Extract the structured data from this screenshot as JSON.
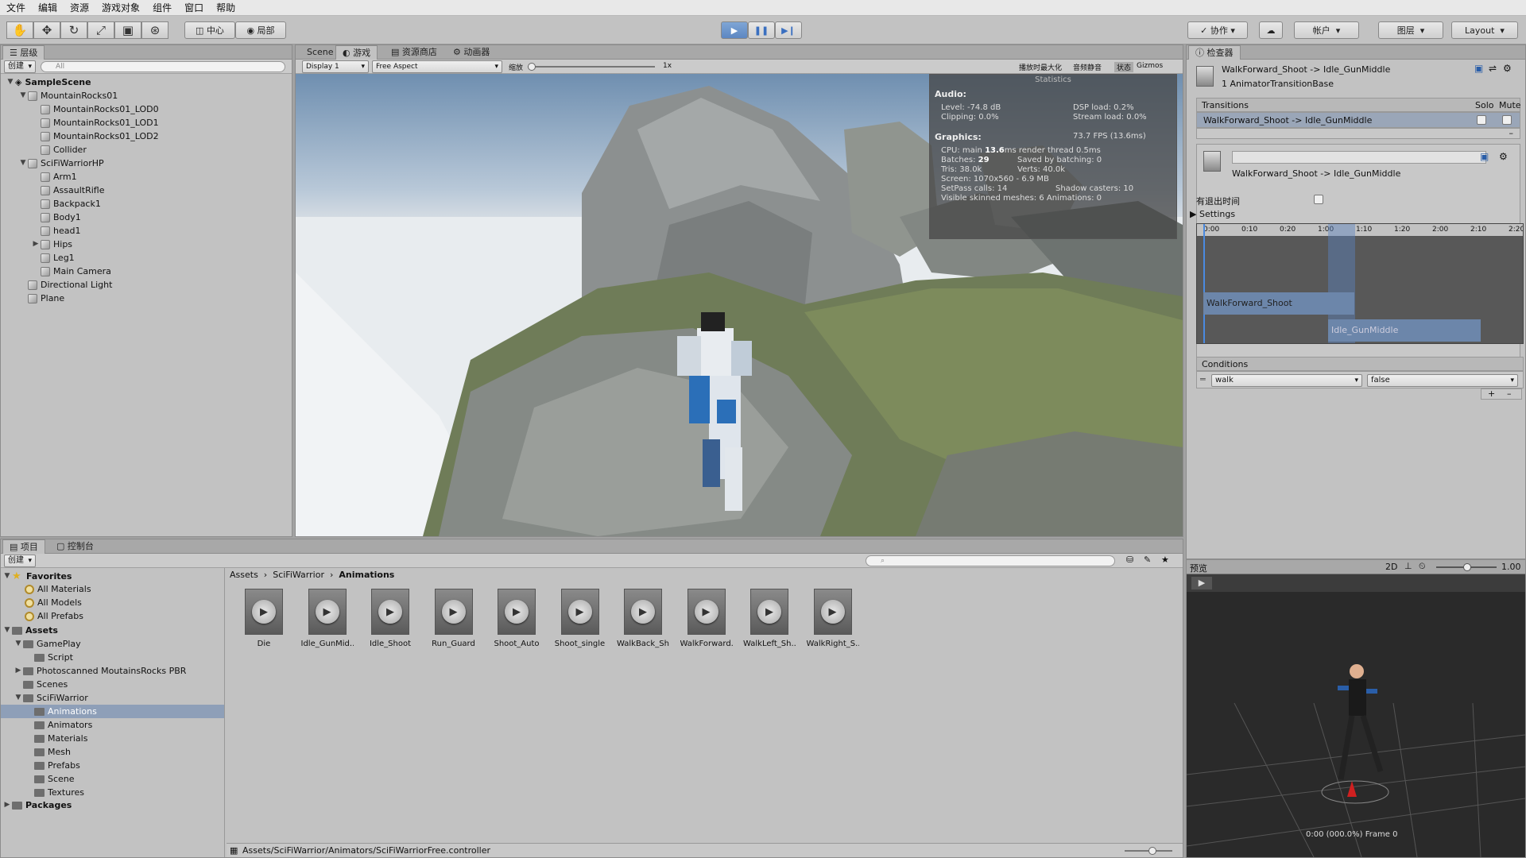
{
  "menu": [
    "文件",
    "编辑",
    "资源",
    "游戏对象",
    "组件",
    "窗口",
    "帮助"
  ],
  "toolbar": {
    "pivot_label": "中心",
    "local_label": "局部",
    "collab_label": "协作",
    "account_label": "帐户",
    "layers_label": "图层",
    "layout_label": "Layout"
  },
  "hierarchy": {
    "tab": "层级",
    "create": "创建",
    "search_placeholder": "All",
    "scene": "SampleScene",
    "items": [
      {
        "label": "MountainRocks01",
        "depth": 1,
        "fold": "▼"
      },
      {
        "label": "MountainRocks01_LOD0",
        "depth": 2,
        "fold": ""
      },
      {
        "label": "MountainRocks01_LOD1",
        "depth": 2,
        "fold": ""
      },
      {
        "label": "MountainRocks01_LOD2",
        "depth": 2,
        "fold": ""
      },
      {
        "label": "Collider",
        "depth": 2,
        "fold": ""
      },
      {
        "label": "SciFiWarriorHP",
        "depth": 1,
        "fold": "▼"
      },
      {
        "label": "Arm1",
        "depth": 2,
        "fold": ""
      },
      {
        "label": "AssaultRifle",
        "depth": 2,
        "fold": ""
      },
      {
        "label": "Backpack1",
        "depth": 2,
        "fold": ""
      },
      {
        "label": "Body1",
        "depth": 2,
        "fold": ""
      },
      {
        "label": "head1",
        "depth": 2,
        "fold": ""
      },
      {
        "label": "Hips",
        "depth": 2,
        "fold": "▶"
      },
      {
        "label": "Leg1",
        "depth": 2,
        "fold": ""
      },
      {
        "label": "Main Camera",
        "depth": 2,
        "fold": ""
      },
      {
        "label": "Directional Light",
        "depth": 1,
        "fold": ""
      },
      {
        "label": "Plane",
        "depth": 1,
        "fold": ""
      }
    ]
  },
  "game": {
    "tabs": [
      "Scene",
      "游戏",
      "资源商店",
      "动画器"
    ],
    "display": "Display 1",
    "aspect": "Free Aspect",
    "scale_label": "缩放",
    "scale_value": "1x",
    "maximize_label": "播放时最大化",
    "mute_label": "音频静音",
    "stats_label": "状态",
    "gizmos_label": "Gizmos",
    "statistics": {
      "title": "Statistics",
      "audio_header": "Audio:",
      "level": "Level: -74.8 dB",
      "clipping": "Clipping: 0.0%",
      "dsp": "DSP load: 0.2%",
      "stream": "Stream load: 0.0%",
      "graphics_header": "Graphics:",
      "fps": "73.7 FPS (13.6ms)",
      "cpu_prefix": "CPU: main",
      "cpu_main": "13.6",
      "cpu_suffix": "ms  render thread 0.5ms",
      "batches_prefix": "Batches:",
      "batches": "29",
      "saved_batching": "Saved by batching: 0",
      "tris": "Tris: 38.0k",
      "verts": "Verts: 40.0k",
      "screen": "Screen: 1070x560 - 6.9 MB",
      "setpass": "SetPass calls: 14",
      "shadow": "Shadow casters: 10",
      "skinned": "Visible skinned meshes: 6  Animations: 0"
    }
  },
  "inspector": {
    "tab": "检查器",
    "title": "WalkForward_Shoot -> Idle_GunMiddle",
    "subtitle": "1 AnimatorTransitionBase",
    "transitions_header": "Transitions",
    "solo": "Solo",
    "mute": "Mute",
    "transition_row": "WalkForward_Shoot -> Idle_GunMiddle",
    "minus": "–",
    "transition_name": "WalkForward_Shoot -> Idle_GunMiddle",
    "has_exit_time": "有退出时间",
    "settings": "Settings",
    "timeline_ticks": [
      "0:00",
      "0:10",
      "0:20",
      "1:00",
      "1:10",
      "1:20",
      "2:00",
      "2:10",
      "2:20"
    ],
    "clip_a": "WalkForward_Shoot",
    "clip_b": "Idle_GunMiddle",
    "conditions_header": "Conditions",
    "condition_param": "walk",
    "condition_value": "false",
    "plus": "+",
    "minus2": "–"
  },
  "preview": {
    "label": "预览",
    "mode_2d": "2D",
    "speed": "1.00",
    "status": "0:00 (000.0%) Frame 0"
  },
  "project": {
    "tab": "项目",
    "console_tab": "控制台",
    "create": "创建",
    "favorites_header": "Favorites",
    "favorites": [
      "All Materials",
      "All Models",
      "All Prefabs"
    ],
    "assets_header": "Assets",
    "assets_tree": [
      {
        "label": "GamePlay",
        "depth": 1,
        "fold": "▼"
      },
      {
        "label": "Script",
        "depth": 2,
        "fold": ""
      },
      {
        "label": "Photoscanned MoutainsRocks PBR",
        "depth": 1,
        "fold": "▶"
      },
      {
        "label": "Scenes",
        "depth": 1,
        "fold": ""
      },
      {
        "label": "SciFiWarrior",
        "depth": 1,
        "fold": "▼"
      },
      {
        "label": "Animations",
        "depth": 2,
        "fold": "",
        "selected": true
      },
      {
        "label": "Animators",
        "depth": 2,
        "fold": ""
      },
      {
        "label": "Materials",
        "depth": 2,
        "fold": ""
      },
      {
        "label": "Mesh",
        "depth": 2,
        "fold": ""
      },
      {
        "label": "Prefabs",
        "depth": 2,
        "fold": ""
      },
      {
        "label": "Scene",
        "depth": 2,
        "fold": ""
      },
      {
        "label": "Textures",
        "depth": 2,
        "fold": ""
      }
    ],
    "packages_header": "Packages",
    "breadcrumb": [
      "Assets",
      "SciFiWarrior",
      "Animations"
    ],
    "animations": [
      "Die",
      "Idle_GunMid...",
      "Idle_Shoot",
      "Run_Guard",
      "Shoot_Auto",
      "Shoot_single",
      "WalkBack_Sh...",
      "WalkForward...",
      "WalkLeft_Sh...",
      "WalkRight_S..."
    ],
    "footer_path": "Assets/SciFiWarrior/Animators/SciFiWarriorFree.controller"
  }
}
